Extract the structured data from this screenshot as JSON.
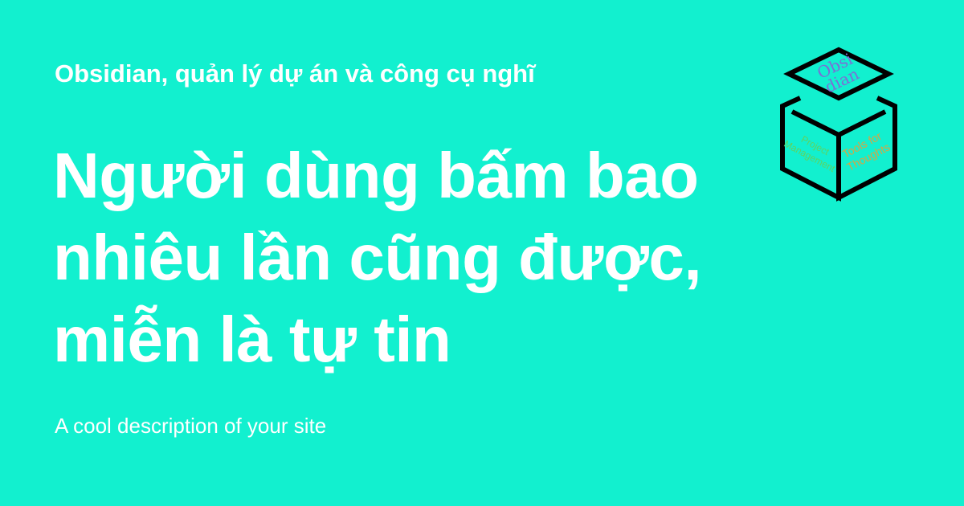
{
  "site_title": "Obsidian, quản lý dự án và công cụ nghĩ",
  "headline": "Người dùng bấm bao nhiêu lần cũng được, miễn là tự tin",
  "description": "A cool description of your site",
  "logo": {
    "top_text_line1": "Obsi",
    "top_text_line2": "dian",
    "left_text_line1": "Project",
    "left_text_line2": "Management",
    "right_text_line1": "Tools for",
    "right_text_line2": "Thoughts"
  },
  "colors": {
    "background": "#12f0cf",
    "text": "#ffffff",
    "logo_stroke": "#000000",
    "logo_top_text": "#7b6fd6",
    "logo_left_text": "#5fd35f",
    "logo_right_text": "#d9a441"
  }
}
